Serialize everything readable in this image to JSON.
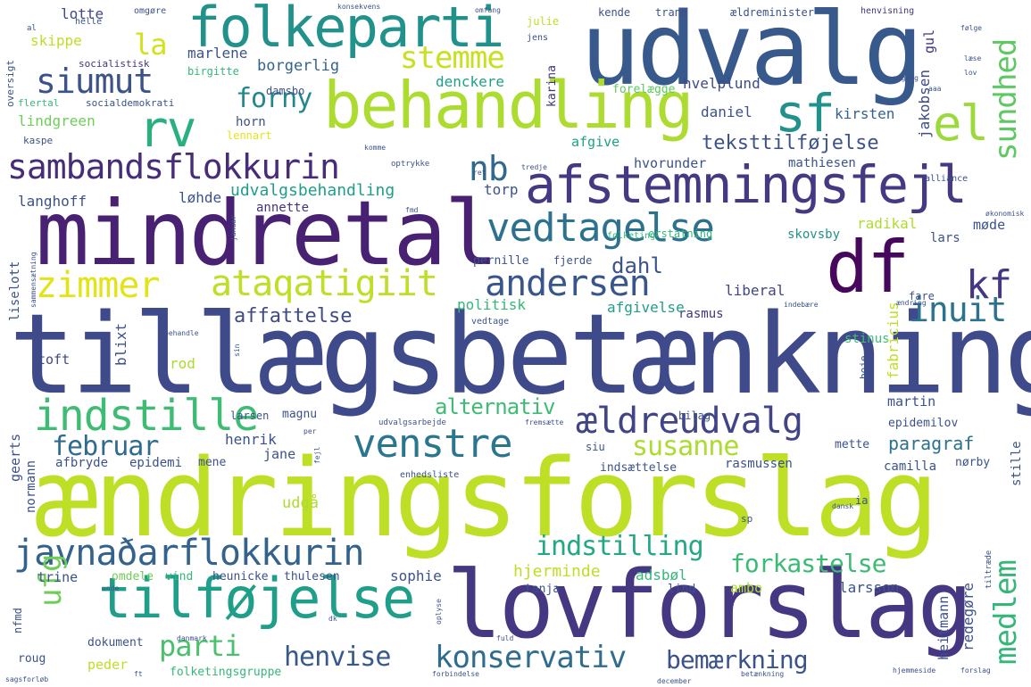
{
  "words": [
    "tillægsbetænkning",
    "ændringsforslag",
    "mindretal",
    "udvalg",
    "lovforslag",
    "behandling",
    "folkeparti",
    "afstemningsfejl",
    "tilføjelse",
    "sambandsflokkurin",
    "vedtagelse",
    "indstille",
    "venstre",
    "javnaðarflokkurin",
    "ældreudvalg",
    "df",
    "rv",
    "zimmer",
    "ataqatigiit",
    "andersen",
    "siumut",
    "konservativ",
    "indstilling",
    "forkastelse",
    "sf",
    "el",
    "nb",
    "kf",
    "inuit",
    "stemme",
    "la",
    "sundhed",
    "medlem",
    "ufg",
    "februar",
    "susanne",
    "parti",
    "henvise",
    "bemærkning",
    "forny",
    "alternativ",
    "teksttilføjelse",
    "affattelse",
    "dahl",
    "paragraf",
    "udvalgsbehandling",
    "langhoff",
    "lindgreen",
    "borgerlig",
    "marlene",
    "skippe",
    "lotte",
    "denckere",
    "hvelplund",
    "daniel",
    "kirsten",
    "jakobsen",
    "gul",
    "afgive",
    "hvorunder",
    "mathiesen",
    "torp",
    "løhde",
    "annette",
    "radikal",
    "skovsby",
    "lars",
    "møde",
    "liberal",
    "rasmus",
    "politisk",
    "afgivelse",
    "stinus",
    "fabricius",
    "liselott",
    "toft",
    "rod",
    "blixt",
    "martin",
    "epidemilov",
    "henrik",
    "jane",
    "mette",
    "rasmussen",
    "camilla",
    "nørby",
    "stille",
    "geerts",
    "normann",
    "afbryde",
    "epidemi",
    "mene",
    "udgå",
    "hjerminde",
    "adsbøl",
    "sophie",
    "trine",
    "omdele",
    "vind",
    "heunicke",
    "thulesen",
    "tanja",
    "lind",
    "ambo",
    "larsson",
    "heitmann",
    "redegøre",
    "peder",
    "dokument",
    "folketingsgruppe",
    "roug",
    "nfmd",
    "birgitte",
    "socialistisk",
    "oversigt",
    "flertal",
    "socialdemokrati",
    "kaspe",
    "damsbo",
    "horn",
    "lennart",
    "karina",
    "julie",
    "jens",
    "kende",
    "trane",
    "ældreminister",
    "henvisning",
    "forelægge",
    "omgøre",
    "helle",
    "al",
    "optrykke",
    "alliance",
    "fjerde",
    "pernille",
    "folketing",
    "erstatning",
    "fare",
    "indsættelse",
    "enhedsliste",
    "siu",
    "magnu",
    "bilag",
    "larsen",
    "udvalgsarbejde",
    "boje",
    "ia",
    "sp",
    "dansk",
    "fuld",
    "tiltræde",
    "forslag",
    "hjemmeside",
    "betænkning",
    "december",
    "forbindelse",
    "danmark",
    "dk",
    "oplyse",
    "sagsforløb",
    "konsekvens",
    "omfang",
    "følge",
    "læse",
    "lov",
    "adgang",
    "aaa",
    "ret",
    "tredje",
    "komme",
    "økonomisk",
    "ændring",
    "indebære",
    "vedtage",
    "behandle",
    "sin",
    "januar",
    "fmd",
    "sammensætning",
    "per",
    "fejl",
    "fremsætte",
    "unde",
    "ft"
  ]
}
